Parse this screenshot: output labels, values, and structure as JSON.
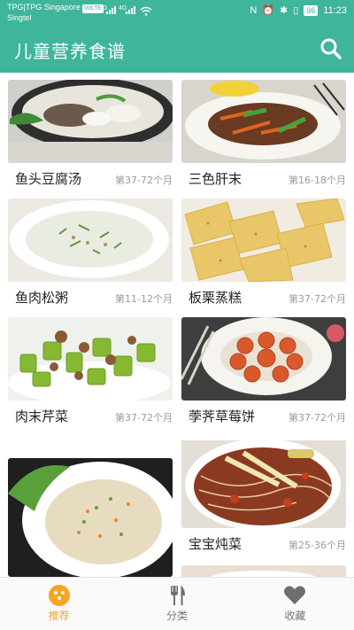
{
  "status_bar": {
    "carrier_line1": "TPG|TPG Singapore",
    "carrier_badge": "VoLTE",
    "carrier_line2": "Singtel",
    "net1": "4G",
    "net2": "4G",
    "battery": "96",
    "time": "11:23"
  },
  "header": {
    "title": "儿童营养食谱",
    "search_icon": "search-icon"
  },
  "recipes": [
    {
      "name": "鱼头豆腐汤",
      "age": "第37-72个月"
    },
    {
      "name": "三色肝末",
      "age": "第16-18个月"
    },
    {
      "name": "鱼肉松粥",
      "age": "第11-12个月"
    },
    {
      "name": "板栗蒸糕",
      "age": "第37-72个月"
    },
    {
      "name": "肉末芹菜",
      "age": "第37-72个月"
    },
    {
      "name": "荸荠草莓饼",
      "age": "第37-72个月"
    },
    {
      "name": "",
      "age": ""
    },
    {
      "name": "宝宝炖菜",
      "age": "第25-36个月"
    }
  ],
  "bottom_nav": {
    "items": [
      {
        "label": "推荐",
        "icon": "recommend-icon",
        "active": true
      },
      {
        "label": "分类",
        "icon": "fork-knife-icon",
        "active": false
      },
      {
        "label": "收藏",
        "icon": "heart-icon",
        "active": false
      }
    ]
  },
  "colors": {
    "primary": "#3fb59b",
    "accent": "#f5a623",
    "secondary_text": "#9a9a9a"
  }
}
